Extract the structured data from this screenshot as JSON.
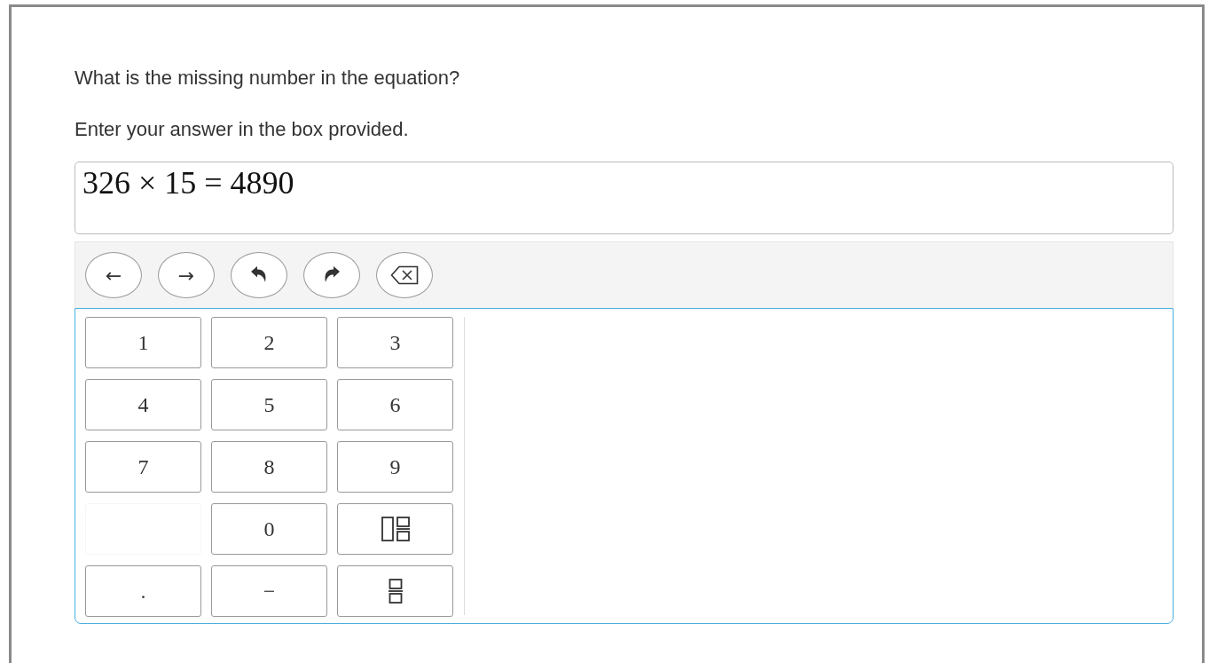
{
  "question": "What is the missing number in the equation?",
  "instruction": "Enter your answer in the box provided.",
  "answer_box": {
    "value": "326 × 15 = 4890"
  },
  "toolbar": [
    {
      "kind": "text",
      "label": "←"
    },
    {
      "kind": "text",
      "label": "→"
    },
    {
      "kind": "undo"
    },
    {
      "kind": "redo"
    },
    {
      "kind": "backspace"
    }
  ],
  "keypad": [
    {
      "kind": "text",
      "label": "1"
    },
    {
      "kind": "text",
      "label": "2"
    },
    {
      "kind": "text",
      "label": "3"
    },
    {
      "kind": "text",
      "label": "4"
    },
    {
      "kind": "text",
      "label": "5"
    },
    {
      "kind": "text",
      "label": "6"
    },
    {
      "kind": "text",
      "label": "7"
    },
    {
      "kind": "text",
      "label": "8"
    },
    {
      "kind": "text",
      "label": "9"
    },
    {
      "kind": "blank"
    },
    {
      "kind": "text",
      "label": "0"
    },
    {
      "kind": "mixed-fraction"
    },
    {
      "kind": "text",
      "label": "."
    },
    {
      "kind": "text",
      "label": "−"
    },
    {
      "kind": "fraction"
    }
  ]
}
